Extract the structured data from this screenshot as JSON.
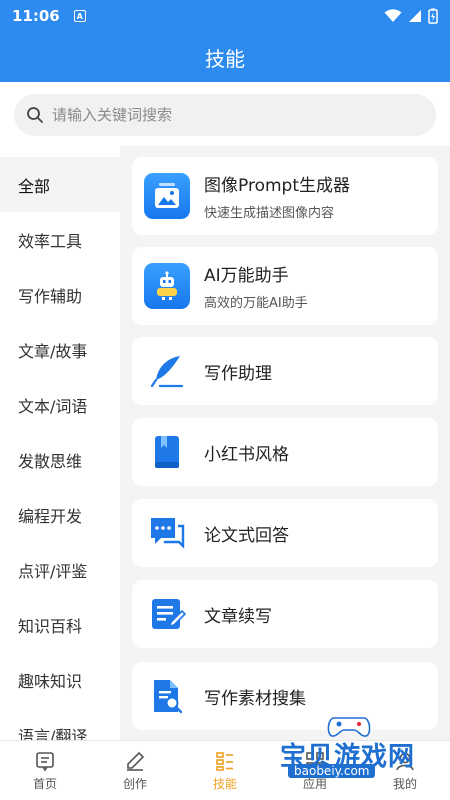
{
  "status": {
    "time": "11:06",
    "a_icon": "A"
  },
  "header": {
    "title": "技能"
  },
  "search": {
    "placeholder": "请输入关键词搜索"
  },
  "sidebar": {
    "items": [
      {
        "label": "全部",
        "active": true
      },
      {
        "label": "效率工具"
      },
      {
        "label": "写作辅助"
      },
      {
        "label": "文章/故事"
      },
      {
        "label": "文本/词语"
      },
      {
        "label": "发散思维"
      },
      {
        "label": "编程开发"
      },
      {
        "label": "点评/评鉴"
      },
      {
        "label": "知识百科"
      },
      {
        "label": "趣味知识"
      },
      {
        "label": "语言/翻译"
      }
    ]
  },
  "skills": [
    {
      "title": "图像Prompt生成器",
      "subtitle": "快速生成描述图像内容",
      "icon": "image-icon"
    },
    {
      "title": "AI万能助手",
      "subtitle": "高效的万能AI助手",
      "icon": "robot-icon"
    },
    {
      "title": "写作助理",
      "icon": "feather-icon"
    },
    {
      "title": "小红书风格",
      "icon": "book-icon"
    },
    {
      "title": "论文式回答",
      "icon": "chat-icon"
    },
    {
      "title": "文章续写",
      "icon": "edit-document-icon"
    },
    {
      "title": "写作素材搜集",
      "icon": "document-search-icon"
    }
  ],
  "tabs": [
    {
      "label": "首页",
      "icon": "home-icon"
    },
    {
      "label": "创作",
      "icon": "pen-icon"
    },
    {
      "label": "技能",
      "icon": "list-icon",
      "active": true
    },
    {
      "label": "应用",
      "icon": "apps-icon"
    },
    {
      "label": "我的",
      "icon": "user-icon"
    }
  ],
  "watermark": {
    "text": "宝贝游戏网",
    "url": "baobeiy.com"
  },
  "colors": {
    "primary": "#2d8bf0",
    "active_tab": "#f0a020",
    "background": "#f4f4f4"
  }
}
